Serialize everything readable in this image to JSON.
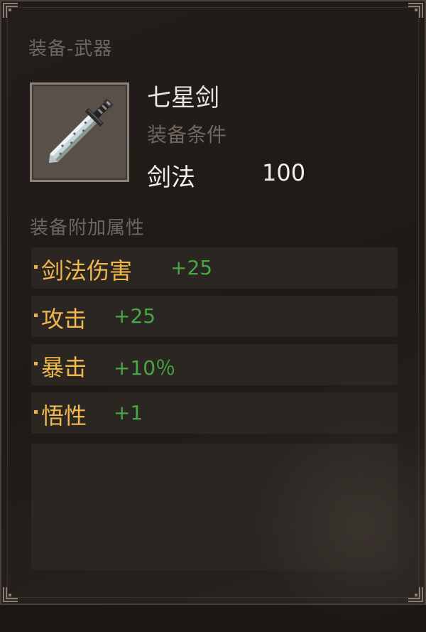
{
  "tooltip": {
    "category_label": "装备-武器",
    "item": {
      "name": "七星剑",
      "icon": "sword-icon"
    },
    "requirements": {
      "label": "装备条件",
      "skill_name": "剑法",
      "skill_value": "100"
    },
    "attributes_label": "装备附加属性",
    "attributes": [
      {
        "name": "剑法伤害",
        "value": "+25"
      },
      {
        "name": "攻击",
        "value": "+25"
      },
      {
        "name": "暴击",
        "value": "+10％"
      },
      {
        "name": "悟性",
        "value": "+1"
      }
    ]
  },
  "colors": {
    "background": "#1f1a17",
    "frame_border": "#4a4039",
    "muted_label": "#6f6660",
    "attribute_name": "#f0b84f",
    "attribute_value": "#48a646",
    "primary_text": "#e8e4df"
  }
}
